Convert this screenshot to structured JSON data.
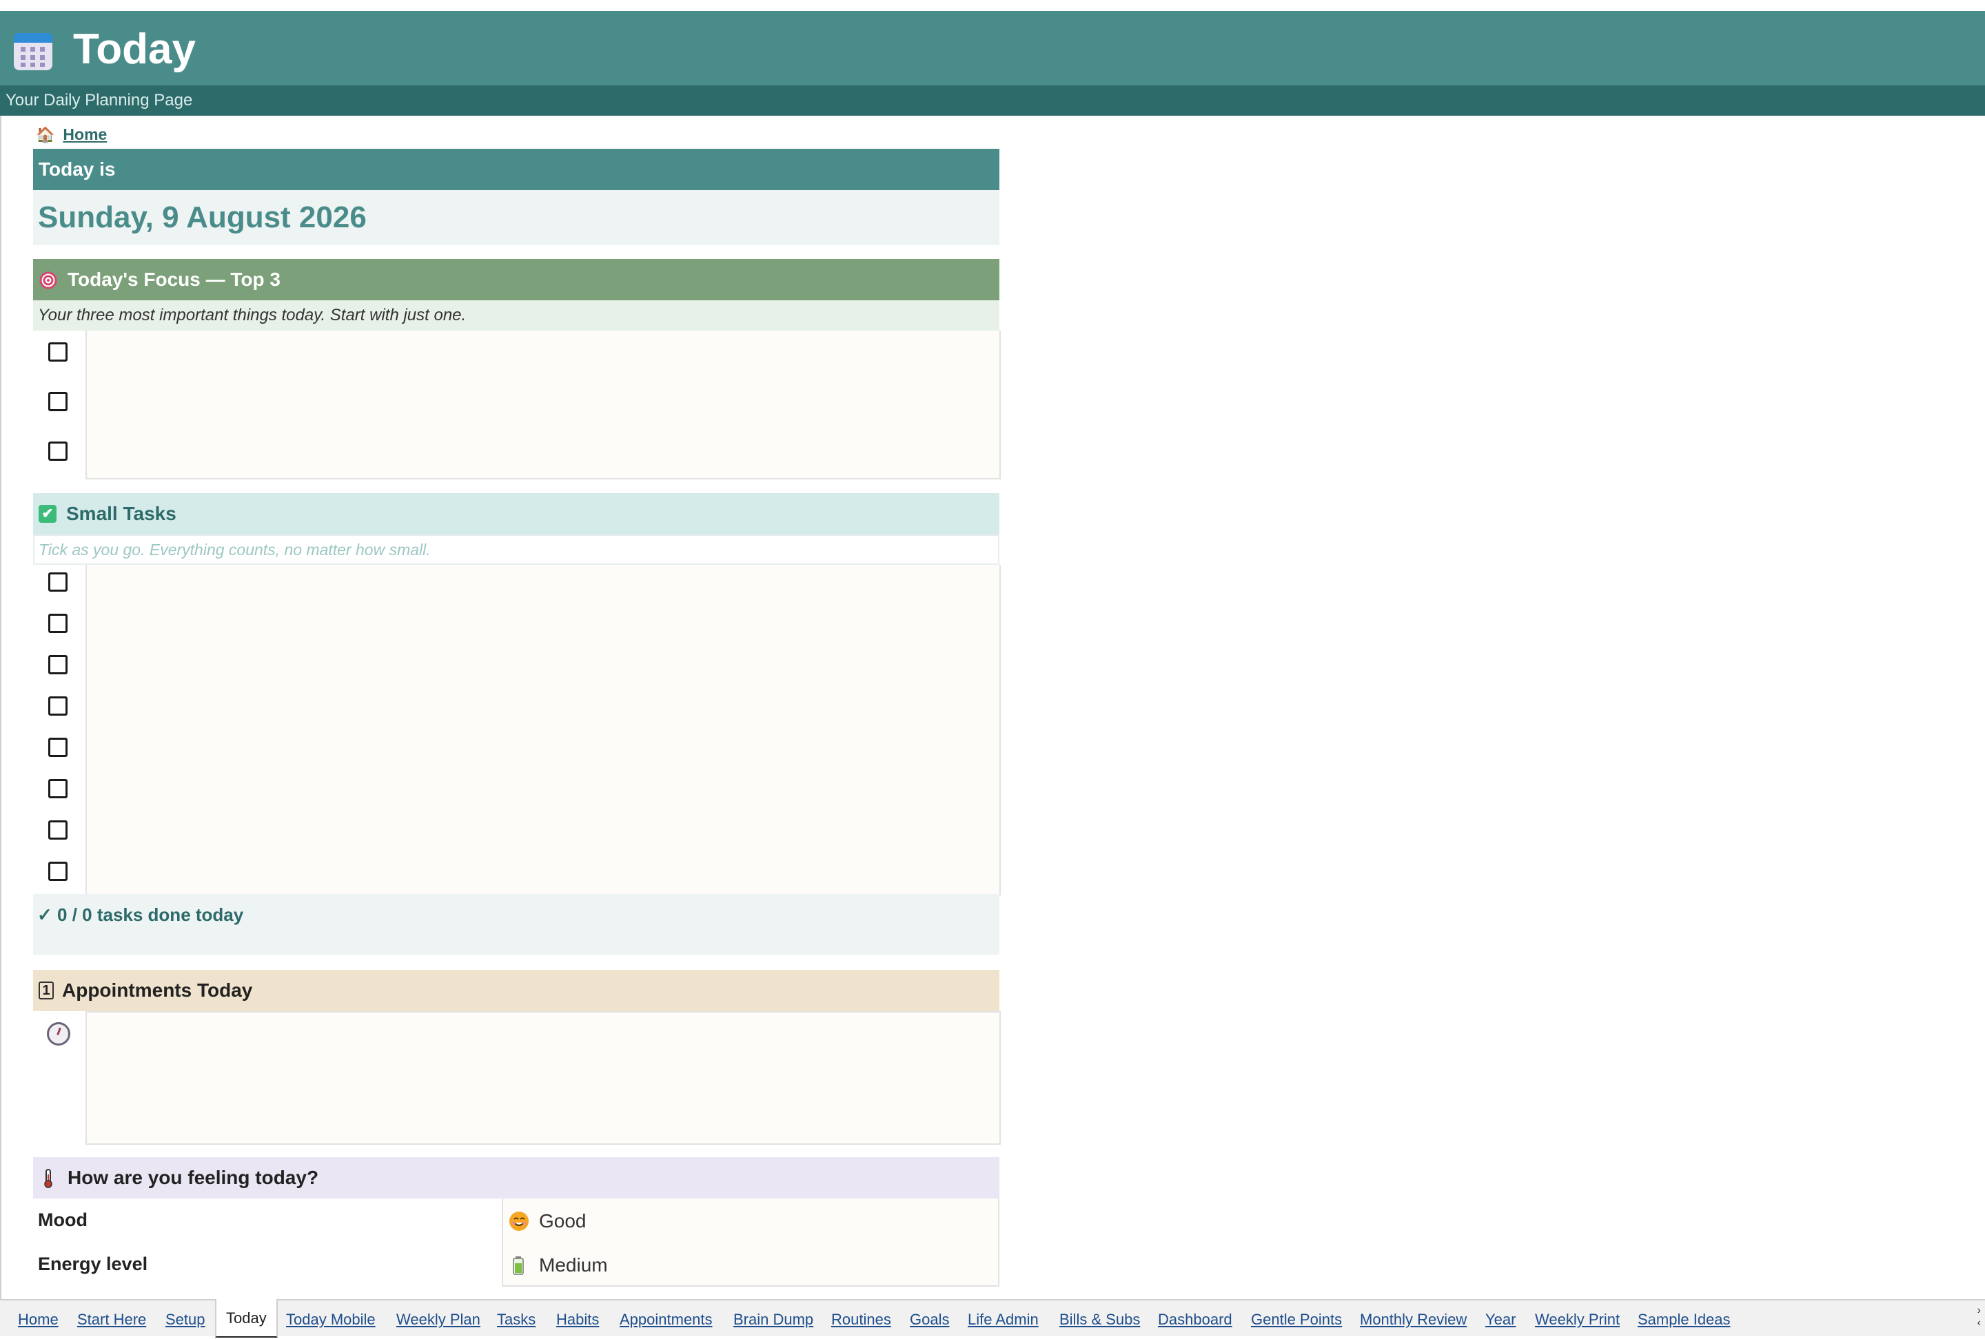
{
  "header": {
    "title": "Today",
    "subtitle": "Your Daily Planning Page",
    "app_icon": "calendar-icon",
    "banner_color": "#4a8c8a",
    "sub_banner_color": "#2d6b6a"
  },
  "nav": {
    "home_icon": "house-icon",
    "home_label": "Home"
  },
  "today": {
    "label": "Today is",
    "date": "Sunday, 9 August 2026"
  },
  "focus": {
    "icon": "target-icon",
    "title": "Today's Focus — Top 3",
    "note": "Your three most important things today. Start with just one.",
    "items": [
      {
        "checked": false,
        "text": ""
      },
      {
        "checked": false,
        "text": ""
      },
      {
        "checked": false,
        "text": ""
      }
    ]
  },
  "small_tasks": {
    "icon": "check-box-icon",
    "title": "Small Tasks",
    "placeholder": "Tick as you go. Everything counts, no matter how small.",
    "items": [
      {
        "checked": false,
        "text": ""
      },
      {
        "checked": false,
        "text": ""
      },
      {
        "checked": false,
        "text": ""
      },
      {
        "checked": false,
        "text": ""
      },
      {
        "checked": false,
        "text": ""
      },
      {
        "checked": false,
        "text": ""
      },
      {
        "checked": false,
        "text": ""
      },
      {
        "checked": false,
        "text": ""
      }
    ],
    "progress": "✓ 0 / 0 tasks done today"
  },
  "appointments": {
    "icon": "calendar-number-icon",
    "title": "Appointments Today",
    "time_icon": "clock-icon"
  },
  "feelings": {
    "icon": "thermometer-icon",
    "title": "How are you feeling today?",
    "mood_label": "Mood",
    "mood_icon": "smiling-face-icon",
    "mood_value": "Good",
    "energy_label": "Energy level",
    "energy_icon": "battery-icon",
    "energy_value": "Medium"
  },
  "tabs": [
    {
      "label": "Home",
      "active": false
    },
    {
      "label": "Start Here",
      "active": false
    },
    {
      "label": "Setup",
      "active": false
    },
    {
      "label": "Today",
      "active": true
    },
    {
      "label": "Today Mobile",
      "active": false
    },
    {
      "label": "Weekly Plan",
      "active": false
    },
    {
      "label": "Tasks",
      "active": false
    },
    {
      "label": "Habits",
      "active": false
    },
    {
      "label": "Appointments",
      "active": false
    },
    {
      "label": "Brain Dump",
      "active": false
    },
    {
      "label": "Routines",
      "active": false
    },
    {
      "label": "Goals",
      "active": false
    },
    {
      "label": "Life Admin",
      "active": false
    },
    {
      "label": "Bills & Subs",
      "active": false
    },
    {
      "label": "Dashboard",
      "active": false
    },
    {
      "label": "Gentle Points",
      "active": false
    },
    {
      "label": "Monthly Review",
      "active": false
    },
    {
      "label": "Year",
      "active": false
    },
    {
      "label": "Weekly Print",
      "active": false
    },
    {
      "label": "Sample Ideas",
      "active": false
    }
  ]
}
